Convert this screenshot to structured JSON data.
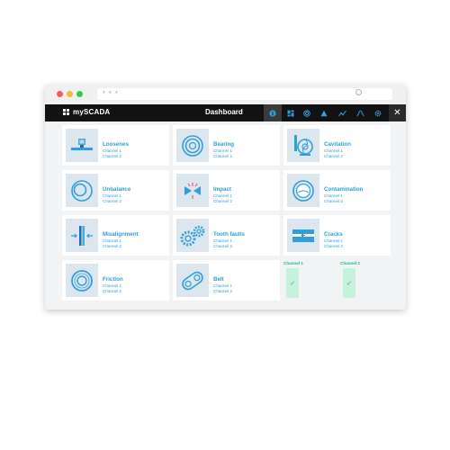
{
  "app": {
    "brand": "mySCADA",
    "page_title": "Dashboard",
    "url_dots": "• • •",
    "toolbar_icons": [
      "info-icon",
      "dashboard-icon",
      "target-icon",
      "warning-icon",
      "trend-icon",
      "wave-icon",
      "gear-icon"
    ],
    "close_label": "✕"
  },
  "cards": [
    {
      "title": "Loosenes",
      "ch1": "Channel 1",
      "ch2": "Channel 2",
      "icon": "looseness-icon"
    },
    {
      "title": "Bearing",
      "ch1": "Channel 1",
      "ch2": "Channel 2",
      "icon": "bearing-icon"
    },
    {
      "title": "Cavitation",
      "ch1": "Channel 1",
      "ch2": "Channel 2",
      "icon": "cavitation-icon"
    },
    {
      "title": "Unbalance",
      "ch1": "Channel 1",
      "ch2": "Channel 2",
      "icon": "unbalance-icon"
    },
    {
      "title": "Impact",
      "ch1": "Channel 1",
      "ch2": "Channel 2",
      "icon": "impact-icon"
    },
    {
      "title": "Contamination",
      "ch1": "Channel 1",
      "ch2": "Channel 2",
      "icon": "contamination-icon"
    },
    {
      "title": "Misalignment",
      "ch1": "Channel 1",
      "ch2": "Channel 2",
      "icon": "misalignment-icon"
    },
    {
      "title": "Tooth faults",
      "ch1": "Channel 1",
      "ch2": "Channel 2",
      "icon": "gears-icon"
    },
    {
      "title": "Cracks",
      "ch1": "Channel 1",
      "ch2": "Channel 2",
      "icon": "cracks-icon"
    },
    {
      "title": "Friction",
      "ch1": "Channel 1",
      "ch2": "Channel 2",
      "icon": "friction-icon"
    },
    {
      "title": "Belt",
      "ch1": "Channel 1",
      "ch2": "Channel 2",
      "icon": "belt-icon"
    }
  ],
  "status": {
    "channel1": {
      "label": "Channel 1",
      "state": "✓"
    },
    "channel2": {
      "label": "Channel 2",
      "state": "✓"
    }
  },
  "colors": {
    "accent": "#2e9fd9",
    "ok": "#1fb889",
    "ok_bg": "#c6f1dc",
    "topbar": "#121212",
    "thumb_bg": "#dce6ee"
  }
}
